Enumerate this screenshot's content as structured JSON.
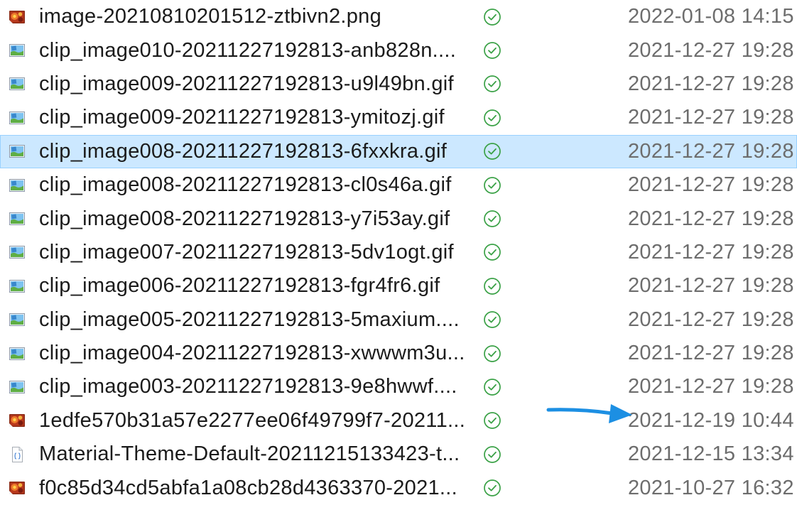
{
  "files": [
    {
      "name": "image-20210810201512-ztbivn2.png",
      "icon": "png-image-icon",
      "status": "check-circle-icon",
      "modified": "2022-01-08 14:15",
      "selected": false
    },
    {
      "name": "clip_image010-20211227192813-anb828n....",
      "icon": "gif-image-icon",
      "status": "check-circle-icon",
      "modified": "2021-12-27 19:28",
      "selected": false
    },
    {
      "name": "clip_image009-20211227192813-u9l49bn.gif",
      "icon": "gif-image-icon",
      "status": "check-circle-icon",
      "modified": "2021-12-27 19:28",
      "selected": false
    },
    {
      "name": "clip_image009-20211227192813-ymitozj.gif",
      "icon": "gif-image-icon",
      "status": "check-circle-icon",
      "modified": "2021-12-27 19:28",
      "selected": false
    },
    {
      "name": "clip_image008-20211227192813-6fxxkra.gif",
      "icon": "gif-image-icon",
      "status": "check-circle-icon",
      "modified": "2021-12-27 19:28",
      "selected": true
    },
    {
      "name": "clip_image008-20211227192813-cl0s46a.gif",
      "icon": "gif-image-icon",
      "status": "check-circle-icon",
      "modified": "2021-12-27 19:28",
      "selected": false
    },
    {
      "name": "clip_image008-20211227192813-y7i53ay.gif",
      "icon": "gif-image-icon",
      "status": "check-circle-icon",
      "modified": "2021-12-27 19:28",
      "selected": false
    },
    {
      "name": "clip_image007-20211227192813-5dv1ogt.gif",
      "icon": "gif-image-icon",
      "status": "check-circle-icon",
      "modified": "2021-12-27 19:28",
      "selected": false
    },
    {
      "name": "clip_image006-20211227192813-fgr4fr6.gif",
      "icon": "gif-image-icon",
      "status": "check-circle-icon",
      "modified": "2021-12-27 19:28",
      "selected": false
    },
    {
      "name": "clip_image005-20211227192813-5maxium....",
      "icon": "gif-image-icon",
      "status": "check-circle-icon",
      "modified": "2021-12-27 19:28",
      "selected": false
    },
    {
      "name": "clip_image004-20211227192813-xwwwm3u...",
      "icon": "gif-image-icon",
      "status": "check-circle-icon",
      "modified": "2021-12-27 19:28",
      "selected": false
    },
    {
      "name": "clip_image003-20211227192813-9e8hwwf....",
      "icon": "gif-image-icon",
      "status": "check-circle-icon",
      "modified": "2021-12-27 19:28",
      "selected": false
    },
    {
      "name": "1edfe570b31a57e2277ee06f49799f7-20211...",
      "icon": "png-image-icon",
      "status": "check-circle-icon",
      "modified": "2021-12-19 10:44",
      "selected": false
    },
    {
      "name": "Material-Theme-Default-20211215133423-t...",
      "icon": "json-file-icon",
      "status": "check-circle-icon",
      "modified": "2021-12-15 13:34",
      "selected": false
    },
    {
      "name": "f0c85d34cd5abfa1a08cb28d4363370-2021...",
      "icon": "png-image-icon",
      "status": "check-circle-icon",
      "modified": "2021-10-27 16:32",
      "selected": false
    }
  ],
  "annotation": {
    "icon": "arrow-right-icon",
    "color": "#1c8fe3"
  },
  "colors": {
    "selection_background": "#cce8ff",
    "selection_border": "#99d1ff",
    "sync_check": "#3aa146",
    "date_text": "#6d6d6d",
    "name_text": "#1b1b1b"
  }
}
